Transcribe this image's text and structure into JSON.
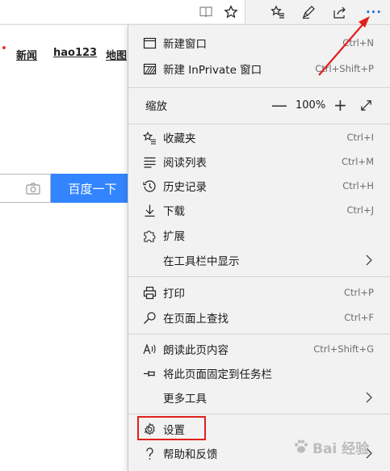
{
  "page": {
    "nav_links": [
      "新闻",
      "hao123",
      "地图"
    ],
    "search_button": "百度一下"
  },
  "menu": {
    "new_window": {
      "label": "新建窗口",
      "shortcut": "Ctrl+N"
    },
    "new_inprivate": {
      "label": "新建 InPrivate 窗口",
      "shortcut": "Ctrl+Shift+P"
    },
    "zoom": {
      "label": "缩放",
      "minus": "—",
      "value": "100%",
      "plus": "+"
    },
    "favorites": {
      "label": "收藏夹",
      "shortcut": "Ctrl+I"
    },
    "reading_list": {
      "label": "阅读列表",
      "shortcut": "Ctrl+M"
    },
    "history": {
      "label": "历史记录",
      "shortcut": "Ctrl+H"
    },
    "downloads": {
      "label": "下载",
      "shortcut": "Ctrl+J"
    },
    "extensions": {
      "label": "扩展"
    },
    "show_in_toolbar": {
      "label": "在工具栏中显示"
    },
    "print": {
      "label": "打印",
      "shortcut": "Ctrl+P"
    },
    "find_on_page": {
      "label": "在页面上查找",
      "shortcut": "Ctrl+F"
    },
    "read_aloud": {
      "label": "朗读此页内容",
      "shortcut": "Ctrl+Shift+G"
    },
    "pin_to_taskbar": {
      "label": "将此页面固定到任务栏"
    },
    "more_tools": {
      "label": "更多工具"
    },
    "settings": {
      "label": "设置"
    },
    "help": {
      "label": "帮助和反馈"
    }
  },
  "toolbar": {
    "more_label": "···"
  },
  "watermark": {
    "text": "Bai 经验"
  },
  "colors": {
    "accent": "#1a6fd1",
    "search_button": "#3385ff",
    "highlight": "#e0201c"
  }
}
